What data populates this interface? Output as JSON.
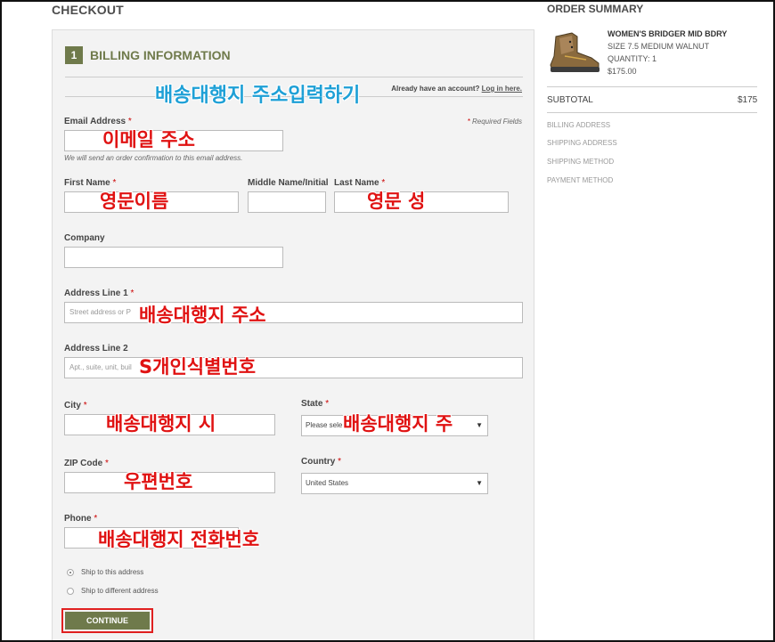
{
  "page": {
    "title": "CHECKOUT"
  },
  "billing": {
    "step_number": "1",
    "step_title": "BILLING INFORMATION",
    "account_prompt": "Already have an account?",
    "login_link": "Log in here.",
    "required_note": "Required Fields",
    "required_star": "*"
  },
  "fields": {
    "email": {
      "label": "Email Address",
      "hint": "We will send an order confirmation to this email address."
    },
    "first_name": {
      "label": "First Name"
    },
    "middle_name": {
      "label": "Middle Name/Initial"
    },
    "last_name": {
      "label": "Last Name"
    },
    "company": {
      "label": "Company"
    },
    "address1": {
      "label": "Address Line 1",
      "placeholder": "Street address or P"
    },
    "address2": {
      "label": "Address Line 2",
      "placeholder": "Apt., suite, unit, buil"
    },
    "city": {
      "label": "City"
    },
    "state": {
      "label": "State",
      "value": "Please sele"
    },
    "zip": {
      "label": "ZIP Code"
    },
    "country": {
      "label": "Country",
      "value": "United States"
    },
    "phone": {
      "label": "Phone"
    }
  },
  "shipping_options": [
    {
      "label": "Ship to this address",
      "selected": true
    },
    {
      "label": "Ship to different address",
      "selected": false
    }
  ],
  "continue_label": "CONTINUE",
  "annotations": {
    "heading": "배송대행지 주소입력하기",
    "email": "이메일 주소",
    "first_name": "영문이름",
    "last_name": "영문 성",
    "address1": "배송대행지 주소",
    "address2": "S개인식별번호",
    "city": "배송대행지 시",
    "state": "배송대행지 주",
    "zip": "우편번호",
    "phone": "배송대행지 전화번호"
  },
  "summary": {
    "title": "ORDER SUMMARY",
    "product_name": "WOMEN'S BRIDGER MID BDRY",
    "product_variant": "SIZE 7.5 MEDIUM WALNUT",
    "product_qty": "QUANTITY: 1",
    "product_price": "$175.00",
    "subtotal_label": "SUBTOTAL",
    "subtotal_value": "$175",
    "steps": [
      "BILLING ADDRESS",
      "SHIPPING ADDRESS",
      "SHIPPING METHOD",
      "PAYMENT METHOD"
    ]
  },
  "colors": {
    "accent": "#6f7a4b",
    "annotation_red": "#e01212",
    "annotation_blue": "#1ea0d6",
    "continue_highlight": "#e02020"
  }
}
